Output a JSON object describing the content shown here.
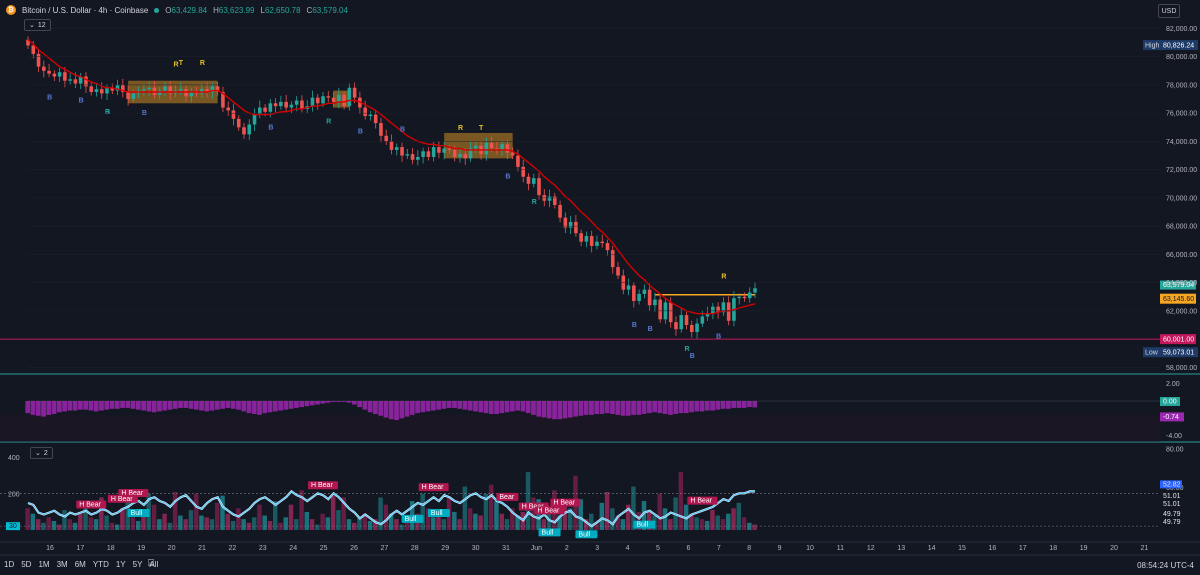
{
  "header": {
    "title": "Bitcoin / U.S. Dollar · 4h · Coinbase",
    "open": "63,429.84",
    "high": "63,623.99",
    "low": "62,650.78",
    "close": "63,579.04",
    "o_label": "O",
    "h_label": "H",
    "l_label": "L",
    "c_label": "C",
    "collapse_label": "12",
    "currency": "USD"
  },
  "price_panel": {
    "y_ticks": [
      "82,000.00",
      "80,000.00",
      "78,000.00",
      "76,000.00",
      "74,000.00",
      "72,000.00",
      "70,000.00",
      "68,000.00",
      "66,000.00",
      "64,000.00",
      "62,000.00",
      "58,000.00"
    ],
    "y_tick_values": [
      82000,
      80000,
      78000,
      76000,
      74000,
      72000,
      70000,
      68000,
      66000,
      64000,
      62000,
      58000
    ],
    "high_label": "High",
    "high_value": "80,826.24",
    "low_label": "Low",
    "low_value": "59,073.01",
    "support_value": "60,001.00",
    "last_price": "63,579.04",
    "orange_level": "63,145.60"
  },
  "osc_panel": {
    "y_ticks": [
      "2.00",
      "-2.00",
      "-4.00"
    ],
    "zero_label": "0.00",
    "value_label": "-0.74"
  },
  "vol_panel": {
    "collapse_label": "2",
    "left_ticks": [
      "400",
      "200"
    ],
    "right_ticks": [
      "80.00",
      "60.00"
    ],
    "labels_right": [
      "52.82",
      "51.01",
      "51.01",
      "49.79",
      "49.79"
    ],
    "rsi_left_value": "30"
  },
  "x_axis": {
    "labels": [
      "16",
      "17",
      "18",
      "19",
      "20",
      "21",
      "22",
      "23",
      "24",
      "25",
      "26",
      "27",
      "28",
      "29",
      "30",
      "31",
      "Jun",
      "2",
      "3",
      "4",
      "5",
      "6",
      "7",
      "8",
      "9",
      "10",
      "11",
      "12",
      "13",
      "14",
      "15",
      "16",
      "17",
      "18",
      "19",
      "20",
      "21"
    ]
  },
  "bottom_bar": {
    "timeframes": [
      "1D",
      "5D",
      "1M",
      "3M",
      "6M",
      "YTD",
      "1Y",
      "5Y",
      "All"
    ],
    "clock": "08:54:24 UTC-4"
  },
  "signals_top": [
    {
      "t": "B",
      "c": "#5b7bd5"
    },
    {
      "t": "B",
      "c": "#5b7bd5"
    },
    {
      "t": "B",
      "c": "#5b7bd5"
    },
    {
      "t": "R",
      "c": "#26a69a"
    },
    {
      "t": "B",
      "c": "#5b7bd5"
    },
    {
      "t": "R",
      "c": "#e6c229"
    },
    {
      "t": "T",
      "c": "#e6c229"
    },
    {
      "t": "R",
      "c": "#e6c229"
    },
    {
      "t": "B",
      "c": "#5b7bd5"
    },
    {
      "t": "R",
      "c": "#26a69a"
    },
    {
      "t": "B",
      "c": "#5b7bd5"
    },
    {
      "t": "B",
      "c": "#5b7bd5"
    },
    {
      "t": "R",
      "c": "#e6c229"
    },
    {
      "t": "T",
      "c": "#e6c229"
    },
    {
      "t": "B",
      "c": "#5b7bd5"
    },
    {
      "t": "R",
      "c": "#26a69a"
    },
    {
      "t": "B",
      "c": "#5b7bd5"
    },
    {
      "t": "B",
      "c": "#5b7bd5"
    },
    {
      "t": "R",
      "c": "#26a69a"
    },
    {
      "t": "B",
      "c": "#5b7bd5"
    },
    {
      "t": "B",
      "c": "#5b7bd5"
    },
    {
      "t": "R",
      "c": "#e6c229"
    }
  ],
  "signals_bottom": [
    "H Bear",
    "H Bear",
    "H Bear",
    "Bull",
    "H Bear",
    "Bull",
    "H Bear",
    "Bear",
    "H Bear",
    "Bull",
    "H Bear",
    "H Bear",
    "Bull",
    "H Bear",
    "Bull",
    "Bull"
  ],
  "chart_data": {
    "type": "candlestick",
    "title": "Bitcoin / U.S. Dollar · 4h · Coinbase",
    "xlabel": "",
    "ylabel": "",
    "ylim": [
      57600,
      82600
    ],
    "x_range": [
      "16",
      "8"
    ],
    "close_series": [
      80800,
      80200,
      79300,
      79000,
      78800,
      78600,
      78900,
      78300,
      78400,
      78100,
      78600,
      77900,
      77500,
      77700,
      77400,
      77800,
      77600,
      78000,
      77500,
      77000,
      77400,
      77600,
      77700,
      77800,
      77300,
      77600,
      77900,
      77400,
      77600,
      77700,
      77200,
      77500,
      77400,
      77700,
      77500,
      77900,
      77500,
      76400,
      76200,
      75600,
      75000,
      74500,
      75200,
      75900,
      76400,
      76100,
      76700,
      76500,
      76800,
      76400,
      76600,
      76900,
      76300,
      76500,
      77100,
      76700,
      77200,
      77100,
      76800,
      77300,
      76500,
      77800,
      77100,
      76400,
      75800,
      75900,
      75300,
      74400,
      74000,
      73400,
      73600,
      73000,
      73100,
      72700,
      72900,
      73300,
      72900,
      73600,
      73200,
      73500,
      73400,
      72900,
      73100,
      72800,
      73500,
      73700,
      73100,
      73900,
      73500,
      73400,
      73800,
      73200,
      73000,
      72200,
      71500,
      71000,
      71400,
      70200,
      69800,
      70100,
      69500,
      68600,
      67900,
      68300,
      67500,
      66900,
      67300,
      66600,
      66900,
      66800,
      66300,
      65100,
      64500,
      63500,
      63800,
      62700,
      63200,
      63500,
      62400,
      62800,
      61400,
      62600,
      61200,
      60700,
      61700,
      61000,
      60500,
      61100,
      61600,
      61800,
      62300,
      61900,
      62600,
      61300,
      62900,
      63000,
      62900,
      63300,
      63600
    ],
    "ema_series": [
      81200,
      80900,
      80500,
      80200,
      79900,
      79600,
      79300,
      79100,
      78900,
      78700,
      78600,
      78400,
      78200,
      78100,
      77900,
      77800,
      77800,
      77700,
      77600,
      77500,
      77500,
      77500,
      77500,
      77500,
      77500,
      77500,
      77500,
      77500,
      77500,
      77500,
      77500,
      77500,
      77500,
      77500,
      77500,
      77600,
      77600,
      77400,
      77100,
      76800,
      76500,
      76200,
      76000,
      75900,
      75900,
      75900,
      75900,
      76000,
      76100,
      76100,
      76200,
      76300,
      76300,
      76400,
      76500,
      76500,
      76600,
      76700,
      76700,
      76800,
      76800,
      76900,
      76900,
      76800,
      76600,
      76400,
      76200,
      75900,
      75600,
      75300,
      75000,
      74700,
      74400,
      74200,
      74000,
      73900,
      73800,
      73800,
      73700,
      73700,
      73600,
      73500,
      73500,
      73400,
      73400,
      73400,
      73400,
      73400,
      73400,
      73400,
      73400,
      73400,
      73300,
      73100,
      72800,
      72500,
      72200,
      71900,
      71500,
      71200,
      70900,
      70500,
      70100,
      69800,
      69400,
      69000,
      68700,
      68300,
      67900,
      67600,
      67200,
      66800,
      66300,
      65800,
      65300,
      64900,
      64500,
      64200,
      63800,
      63500,
      63200,
      62900,
      62600,
      62400,
      62200,
      62000,
      61900,
      61800,
      61800,
      61800,
      61800,
      61900,
      62000,
      62000,
      62100,
      62200,
      62300,
      62400,
      62500
    ],
    "support_level": 60001,
    "orange_level": 63145.6,
    "high": 80826.24,
    "low": 59073.01,
    "last": 63579.04,
    "osc_ylim": [
      -4.5,
      3
    ],
    "osc_values": [
      -1.4,
      -1.6,
      -1.7,
      -1.8,
      -1.6,
      -1.5,
      -1.3,
      -1.2,
      -1.1,
      -1.1,
      -1.0,
      -1.0,
      -1.1,
      -1.2,
      -1.1,
      -1.0,
      -0.9,
      -0.9,
      -0.8,
      -0.8,
      -0.9,
      -1.0,
      -1.1,
      -1.2,
      -1.3,
      -1.2,
      -1.1,
      -1.0,
      -0.9,
      -0.8,
      -0.8,
      -0.9,
      -1.0,
      -1.1,
      -1.2,
      -1.1,
      -1.0,
      -0.9,
      -0.8,
      -0.9,
      -1.0,
      -1.2,
      -1.4,
      -1.5,
      -1.6,
      -1.4,
      -1.3,
      -1.2,
      -1.1,
      -1.0,
      -0.9,
      -0.8,
      -0.7,
      -0.6,
      -0.5,
      -0.4,
      -0.3,
      -0.2,
      -0.1,
      -0.1,
      -0.1,
      -0.2,
      -0.4,
      -0.7,
      -1.0,
      -1.3,
      -1.5,
      -1.7,
      -1.9,
      -2.1,
      -2.2,
      -2.0,
      -1.8,
      -1.6,
      -1.4,
      -1.3,
      -1.2,
      -1.1,
      -1.0,
      -0.9,
      -0.8,
      -0.8,
      -0.9,
      -1.0,
      -1.1,
      -1.2,
      -1.3,
      -1.4,
      -1.5,
      -1.5,
      -1.4,
      -1.3,
      -1.2,
      -1.1,
      -1.2,
      -1.4,
      -1.6,
      -1.8,
      -1.9,
      -2.0,
      -2.1,
      -2.1,
      -2.0,
      -1.9,
      -1.8,
      -1.7,
      -1.6,
      -1.6,
      -1.5,
      -1.5,
      -1.4,
      -1.5,
      -1.6,
      -1.7,
      -1.7,
      -1.6,
      -1.6,
      -1.5,
      -1.4,
      -1.3,
      -1.4,
      -1.5,
      -1.6,
      -1.5,
      -1.4,
      -1.4,
      -1.3,
      -1.2,
      -1.2,
      -1.1,
      -1.1,
      -1.0,
      -0.9,
      -0.9,
      -0.8,
      -0.8,
      -0.8,
      -0.7,
      -0.74
    ],
    "vol_ylim": [
      0,
      470
    ],
    "volume": [
      120,
      90,
      60,
      40,
      70,
      50,
      30,
      110,
      60,
      40,
      90,
      160,
      70,
      60,
      180,
      80,
      40,
      30,
      120,
      200,
      70,
      50,
      80,
      200,
      140,
      60,
      90,
      40,
      210,
      80,
      60,
      110,
      200,
      80,
      70,
      60,
      150,
      190,
      90,
      50,
      120,
      60,
      40,
      70,
      140,
      80,
      50,
      160,
      40,
      70,
      140,
      60,
      220,
      100,
      60,
      30,
      90,
      70,
      190,
      110,
      180,
      60,
      40,
      70,
      90,
      50,
      60,
      180,
      140,
      90,
      60,
      30,
      50,
      160,
      90,
      200,
      120,
      70,
      80,
      60,
      180,
      100,
      60,
      240,
      120,
      90,
      80,
      200,
      250,
      160,
      90,
      60,
      120,
      80,
      100,
      320,
      180,
      170,
      60,
      90,
      220,
      80,
      140,
      120,
      300,
      170,
      60,
      90,
      40,
      150,
      210,
      120,
      80,
      60,
      140,
      240,
      100,
      160,
      110,
      80,
      200,
      120,
      60,
      180,
      320,
      140,
      90,
      70,
      60,
      50,
      110,
      80,
      60,
      90,
      120,
      150,
      70,
      40,
      30
    ],
    "rsi_ylim": [
      38,
      82
    ],
    "rsi": [
      52,
      51,
      47,
      46,
      47,
      48,
      46,
      45,
      47,
      46,
      47,
      48,
      46,
      47,
      49,
      48,
      46,
      47,
      49,
      50,
      52,
      53,
      51,
      54,
      55,
      53,
      52,
      50,
      53,
      55,
      56,
      53,
      50,
      49,
      52,
      54,
      55,
      50,
      48,
      46,
      45,
      47,
      49,
      52,
      54,
      55,
      53,
      51,
      53,
      55,
      58,
      56,
      55,
      53,
      55,
      57,
      56,
      54,
      57,
      55,
      52,
      49,
      47,
      44,
      46,
      44,
      42,
      41,
      43,
      46,
      48,
      46,
      48,
      50,
      52,
      51,
      53,
      55,
      53,
      56,
      55,
      53,
      52,
      54,
      56,
      57,
      55,
      54,
      56,
      53,
      52,
      50,
      47,
      45,
      43,
      47,
      45,
      44,
      46,
      43,
      42,
      45,
      47,
      48,
      45,
      44,
      42,
      40,
      42,
      44,
      43,
      41,
      45,
      47,
      49,
      46,
      44,
      47,
      48,
      46,
      44,
      45,
      47,
      46,
      45,
      44,
      46,
      47,
      48,
      49,
      50,
      52,
      54,
      53,
      56,
      57,
      57,
      58,
      58
    ]
  }
}
